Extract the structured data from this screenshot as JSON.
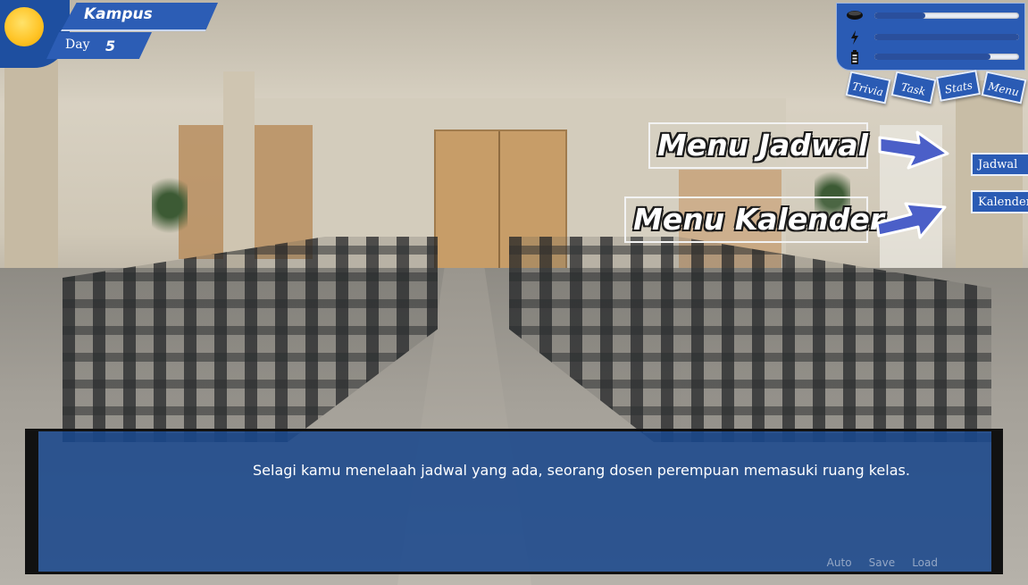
{
  "hud": {
    "location": "Kampus",
    "day_label": "Day",
    "day_value": "5",
    "time_icon": "sun-icon"
  },
  "stats": [
    {
      "name": "hunger",
      "icon": "food-bowl-icon",
      "level_percent": 35
    },
    {
      "name": "energy",
      "icon": "lightning-icon",
      "level_percent": 100
    },
    {
      "name": "battery",
      "icon": "battery-icon",
      "level_percent": 80
    }
  ],
  "tabs": {
    "trivia": "Trivia",
    "task": "Task",
    "stats": "Stats",
    "menu": "Menu"
  },
  "side_menu": {
    "jadwal": "Jadwal",
    "kalender": "Kalender"
  },
  "callouts": {
    "jadwal": "Menu Jadwal",
    "kalender": "Menu Kalender"
  },
  "dialogue": {
    "text": "Selagi kamu menelaah jadwal yang ada, seorang dosen perempuan memasuki ruang kelas."
  },
  "quick_menu": {
    "auto": "Auto",
    "save": "Save",
    "load": "Load"
  },
  "colors": {
    "hud_blue": "#2a5bb4",
    "dialogue_blue": "#1a488c",
    "sun_yellow": "#ffc529",
    "stat_fill": "#2a4f9c"
  }
}
